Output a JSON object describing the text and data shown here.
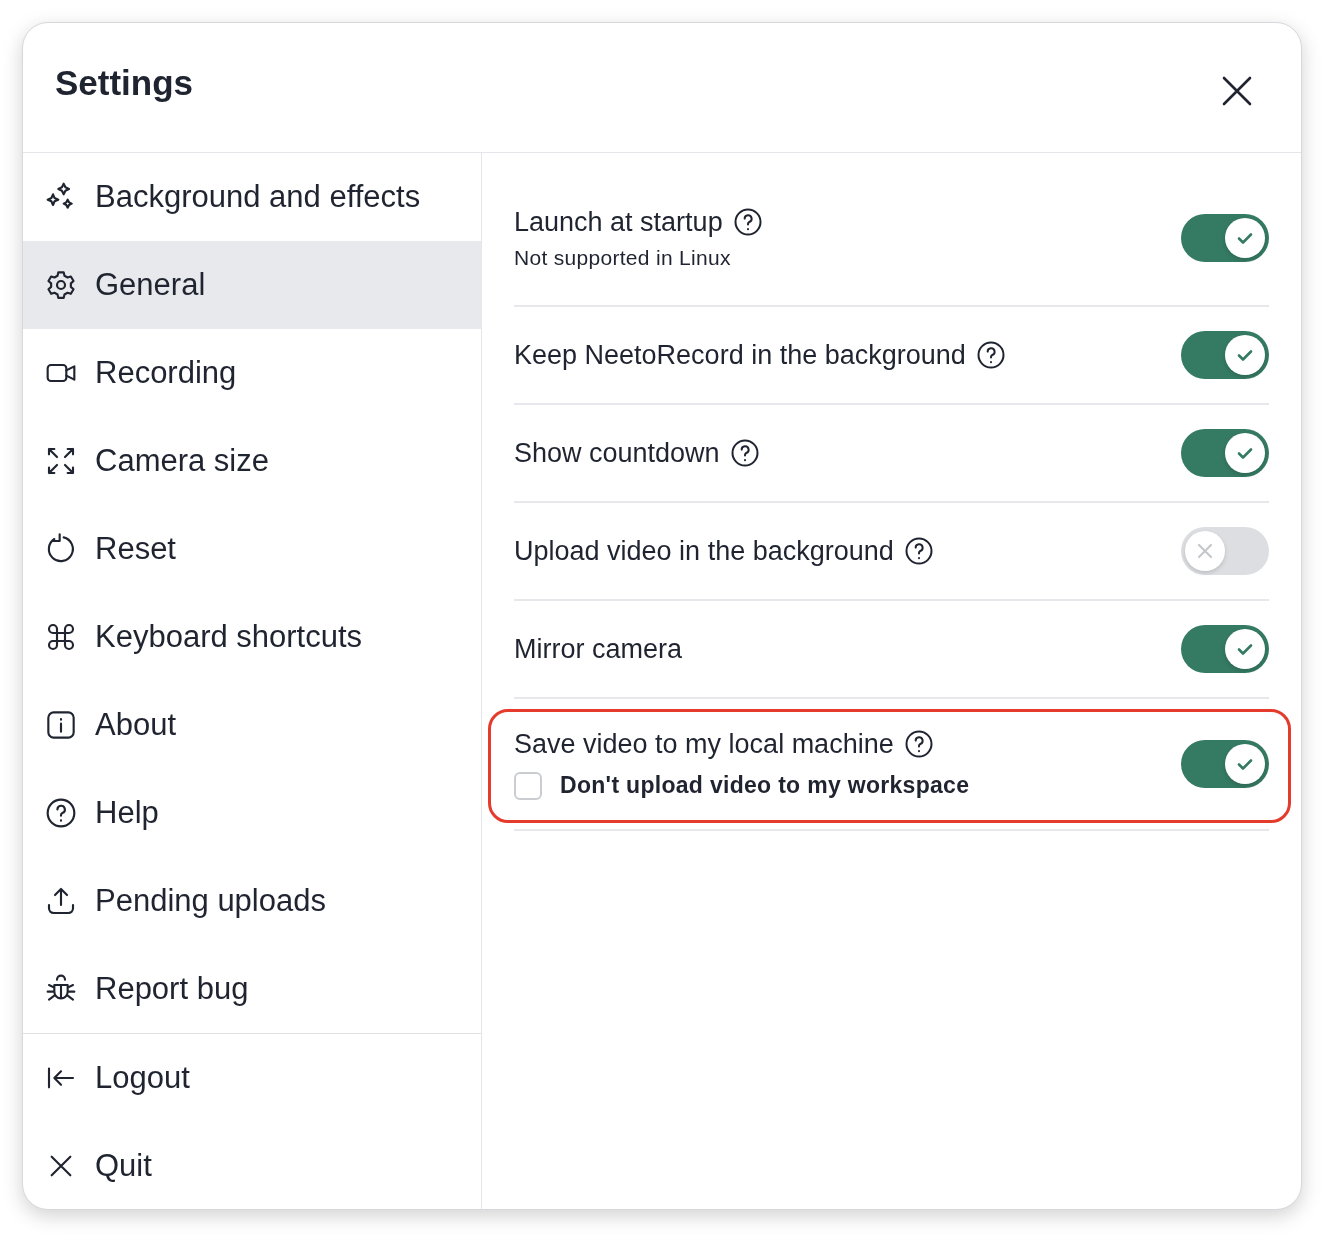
{
  "window": {
    "title": "Settings"
  },
  "sidebar": {
    "items": [
      {
        "label": "Background and effects",
        "selected": false
      },
      {
        "label": "General",
        "selected": true
      },
      {
        "label": "Recording",
        "selected": false
      },
      {
        "label": "Camera size",
        "selected": false
      },
      {
        "label": "Reset",
        "selected": false
      },
      {
        "label": "Keyboard shortcuts",
        "selected": false
      },
      {
        "label": "About",
        "selected": false
      },
      {
        "label": "Help",
        "selected": false
      },
      {
        "label": "Pending uploads",
        "selected": false
      },
      {
        "label": "Report bug",
        "selected": false
      }
    ],
    "footer_items": [
      {
        "label": "Logout",
        "selected": false
      },
      {
        "label": "Quit",
        "selected": false
      }
    ]
  },
  "settings": [
    {
      "label": "Launch at startup",
      "help": true,
      "note": "Not supported in Linux",
      "on": true,
      "highlighted": false
    },
    {
      "label": "Keep NeetoRecord in the background",
      "help": true,
      "on": true,
      "highlighted": false
    },
    {
      "label": "Show countdown",
      "help": true,
      "on": true,
      "highlighted": false
    },
    {
      "label": "Upload video in the background",
      "help": true,
      "on": false,
      "highlighted": false
    },
    {
      "label": "Mirror camera",
      "help": false,
      "on": true,
      "highlighted": false
    },
    {
      "label": "Save video to my local machine",
      "help": true,
      "option": {
        "label": "Don't upload video to my workspace",
        "checked": false
      },
      "on": true,
      "highlighted": true
    }
  ]
}
